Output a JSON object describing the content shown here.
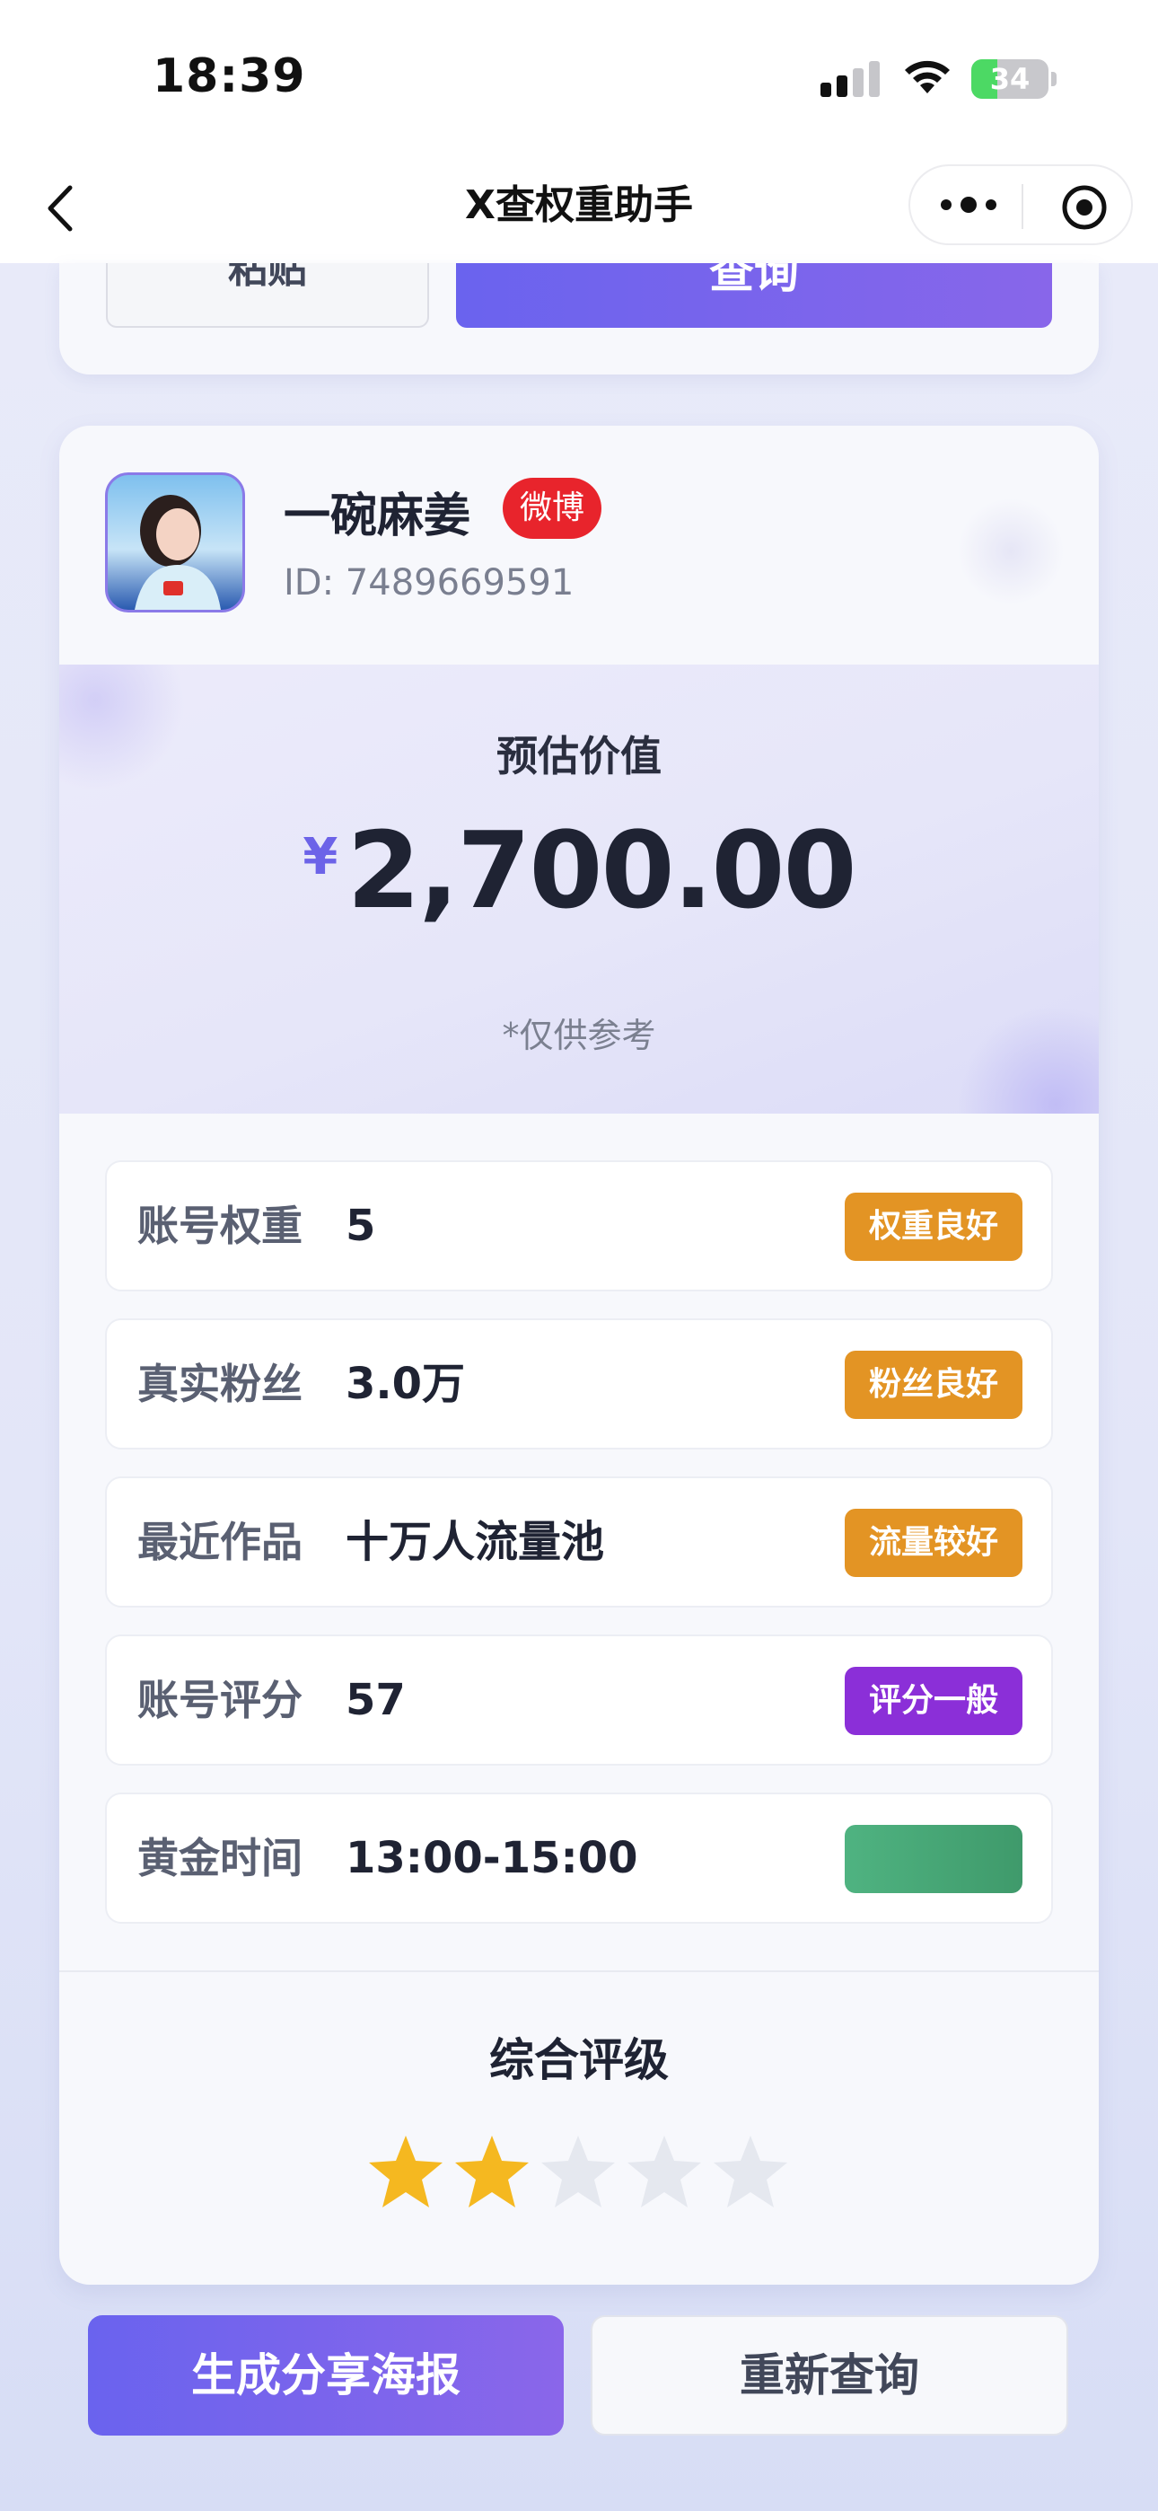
{
  "status_bar": {
    "time": "18:39",
    "battery": "34",
    "battery_level": 0.34
  },
  "nav": {
    "title": "X查权重助手"
  },
  "search_actions": {
    "paste_label": "粘贴",
    "query_label": "查询"
  },
  "profile": {
    "name": "一碗麻姜",
    "platform": "微博",
    "id_text": "ID: 7489669591"
  },
  "valuation": {
    "label": "预估价值",
    "currency": "¥",
    "amount": "2,700.00",
    "note": "*仅供参考"
  },
  "metrics": [
    {
      "label": "账号权重",
      "value": "5",
      "tag": "权重良好",
      "tag_color": "#e39424"
    },
    {
      "label": "真实粉丝",
      "value": "3.0万",
      "tag": "粉丝良好",
      "tag_color": "#e39424"
    },
    {
      "label": "最近作品",
      "value": "十万人流量池",
      "tag": "流量较好",
      "tag_color": "#e39424"
    },
    {
      "label": "账号评分",
      "value": "57",
      "tag": "评分一般",
      "tag_color": "#8b2fd8"
    },
    {
      "label": "黄金时间",
      "value": "13:00-15:00",
      "tag": "",
      "tag_color": "#3f9a6b"
    }
  ],
  "rating": {
    "title": "综合评级",
    "stars_filled": 2,
    "stars_total": 5
  },
  "footer": {
    "share_label": "生成分享海报",
    "requery_label": "重新查询"
  },
  "colors": {
    "accent": "#6c63e8",
    "star_on": "#f5b820",
    "star_off": "#e5e8ef"
  }
}
